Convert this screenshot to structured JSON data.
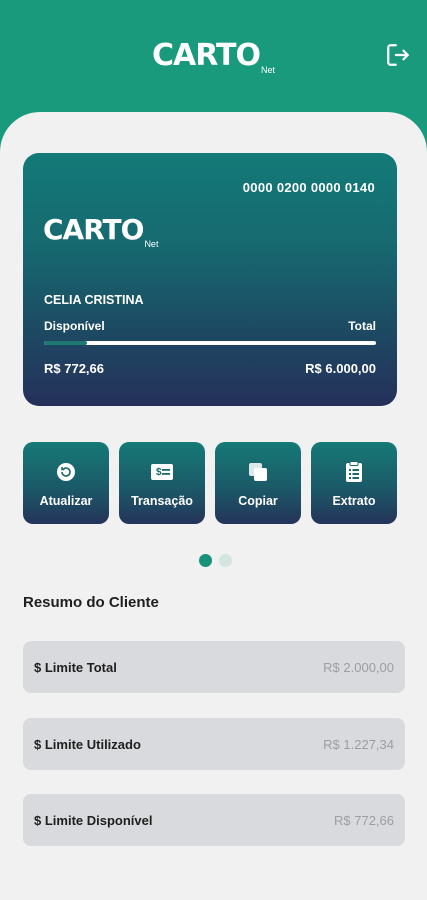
{
  "brand": {
    "logo_word": "CARTO",
    "logo_suffix": "Net"
  },
  "header": {
    "logout_icon": "logout-icon"
  },
  "card": {
    "number": "0000 0200 0000 0140",
    "holder_name": "CELIA CRISTINA",
    "available_label": "Disponível",
    "total_label": "Total",
    "available_value": "R$ 772,66",
    "total_value": "R$ 6.000,00",
    "usage_fraction": 0.129
  },
  "actions": [
    {
      "label": "Atualizar",
      "icon": "refresh-icon"
    },
    {
      "label": "Transação",
      "icon": "transaction-icon"
    },
    {
      "label": "Copiar",
      "icon": "copy-icon"
    },
    {
      "label": "Extrato",
      "icon": "statement-icon"
    }
  ],
  "carousel": {
    "active_index": 0,
    "count": 2
  },
  "summary": {
    "title": "Resumo do Cliente",
    "rows": [
      {
        "label": "$ Limite Total",
        "value": "R$ 2.000,00"
      },
      {
        "label": "$ Limite Utilizado",
        "value": "R$ 1.227,34"
      },
      {
        "label": "$ Limite Disponível",
        "value": "R$ 772,66"
      }
    ]
  },
  "colors": {
    "header": "#1a9a7c",
    "card_top": "#137a78",
    "card_bottom": "#25305a",
    "dot_active": "#179279"
  }
}
